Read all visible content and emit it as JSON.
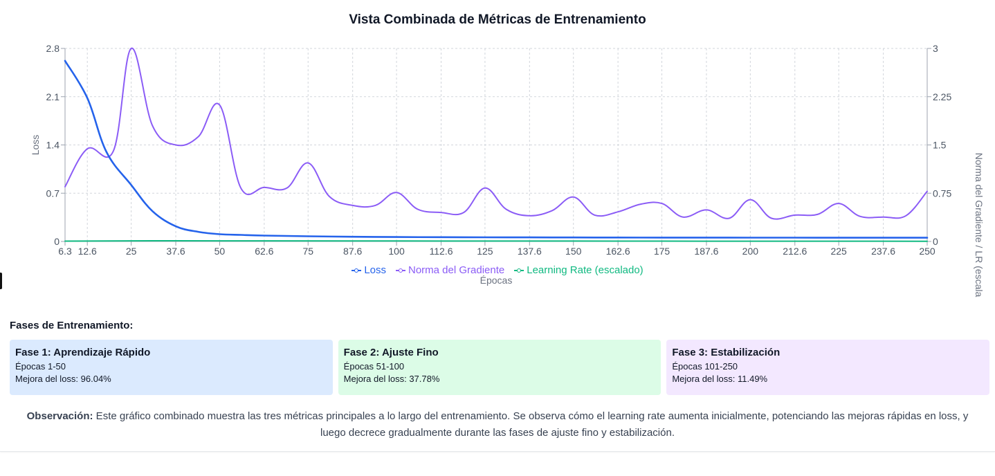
{
  "title": "Vista Combinada de Métricas de Entrenamiento",
  "legend": [
    {
      "label": "Loss",
      "color": "#2563eb"
    },
    {
      "label": "Norma del Gradiente",
      "color": "#8b5cf6"
    },
    {
      "label": "Learning Rate (escalado)",
      "color": "#10b981"
    }
  ],
  "chart_data": {
    "type": "line",
    "xlabel": "Épocas",
    "ylabel_left": "Loss",
    "ylabel_right": "Norma del Gradiente / LR (escala",
    "xlim": [
      6.3,
      250
    ],
    "ylim_left": [
      0,
      2.8
    ],
    "ylim_right": [
      0,
      3
    ],
    "x_ticks": [
      "6.3",
      "12.6",
      "25",
      "37.6",
      "50",
      "62.6",
      "75",
      "87.6",
      "100",
      "112.6",
      "125",
      "137.6",
      "150",
      "162.6",
      "175",
      "187.6",
      "200",
      "212.6",
      "225",
      "237.6",
      "250"
    ],
    "y_ticks_left": [
      "0",
      "0.7",
      "1.4",
      "2.1",
      "2.8"
    ],
    "y_ticks_right": [
      "0",
      "0.75",
      "1.5",
      "2.25",
      "3"
    ],
    "grid": true,
    "legend_position": "bottom",
    "series": [
      {
        "name": "Loss",
        "axis": "left",
        "color": "#2563eb",
        "x": [
          6.3,
          12.6,
          18,
          25,
          31,
          37.6,
          44,
          50,
          56,
          62.6,
          75,
          87.6,
          100,
          112.6,
          125,
          137.6,
          150,
          162.6,
          175,
          187.6,
          200,
          212.6,
          225,
          237.6,
          250
        ],
        "y": [
          2.62,
          2.08,
          1.3,
          0.82,
          0.44,
          0.22,
          0.14,
          0.105,
          0.095,
          0.085,
          0.075,
          0.068,
          0.064,
          0.062,
          0.06,
          0.059,
          0.058,
          0.057,
          0.056,
          0.056,
          0.055,
          0.055,
          0.054,
          0.054,
          0.054
        ]
      },
      {
        "name": "Norma del Gradiente",
        "axis": "right",
        "color": "#8b5cf6",
        "x": [
          6.3,
          12.6,
          20,
          25,
          31,
          37.6,
          44,
          50,
          56,
          62.6,
          69,
          75,
          81,
          87.6,
          94,
          100,
          106,
          112.6,
          119,
          125,
          131,
          137.6,
          144,
          150,
          156,
          162.6,
          169,
          175,
          181,
          187.6,
          194,
          200,
          206,
          212.6,
          219,
          225,
          231,
          237.6,
          244,
          250
        ],
        "y": [
          0.85,
          1.44,
          1.41,
          3.0,
          1.8,
          1.5,
          1.63,
          2.12,
          0.83,
          0.84,
          0.83,
          1.22,
          0.7,
          0.56,
          0.56,
          0.76,
          0.5,
          0.45,
          0.45,
          0.83,
          0.5,
          0.4,
          0.48,
          0.69,
          0.41,
          0.46,
          0.58,
          0.59,
          0.38,
          0.49,
          0.36,
          0.65,
          0.36,
          0.41,
          0.42,
          0.59,
          0.39,
          0.38,
          0.4,
          0.78
        ]
      },
      {
        "name": "Learning Rate (escalado)",
        "axis": "right",
        "color": "#10b981",
        "x": [
          6.3,
          25,
          50,
          100,
          150,
          200,
          250
        ],
        "y": [
          0.005,
          0.01,
          0.01,
          0.008,
          0.006,
          0.004,
          0.003
        ]
      }
    ]
  },
  "phases_title": "Fases de Entrenamiento:",
  "phases": [
    {
      "title": "Fase 1: Aprendizaje Rápido",
      "epochs": "Épocas 1-50",
      "improvement": "Mejora del loss: 96.04%",
      "bg": "#dbeafe"
    },
    {
      "title": "Fase 2: Ajuste Fino",
      "epochs": "Épocas 51-100",
      "improvement": "Mejora del loss: 37.78%",
      "bg": "#dcfce7"
    },
    {
      "title": "Fase 3: Estabilización",
      "epochs": "Épocas 101-250",
      "improvement": "Mejora del loss: 11.49%",
      "bg": "#f3e8ff"
    }
  ],
  "observation": {
    "label": "Observación:",
    "text": " Este gráfico combinado muestra las tres métricas principales a lo largo del entrenamiento. Se observa cómo el learning rate aumenta inicialmente, potenciando las mejoras rápidas en loss, y luego decrece gradualmente durante las fases de ajuste fino y estabilización."
  }
}
